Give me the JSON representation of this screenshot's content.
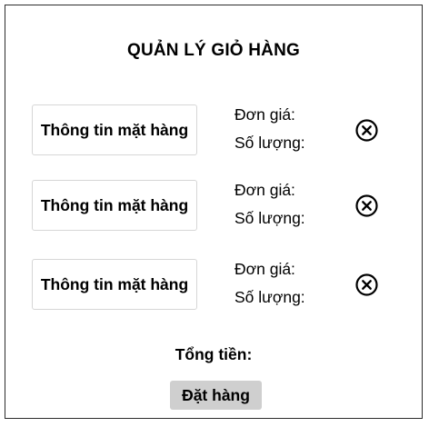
{
  "cart": {
    "title": "QUẢN LÝ GIỎ HÀNG",
    "items": [
      {
        "info_label": "Thông tin mặt hàng",
        "price_label": "Đơn giá:",
        "quantity_label": "Số lượng:",
        "remove_icon": "close-circle-icon"
      },
      {
        "info_label": "Thông tin mặt hàng",
        "price_label": "Đơn giá:",
        "quantity_label": "Số lượng:",
        "remove_icon": "close-circle-icon"
      },
      {
        "info_label": "Thông tin mặt hàng",
        "price_label": "Đơn giá:",
        "quantity_label": "Số lượng:",
        "remove_icon": "close-circle-icon"
      }
    ],
    "total_label": "Tổng tiền:",
    "order_button_label": "Đặt hàng"
  },
  "colors": {
    "button_bg": "#cfcfcf",
    "border": "#2b2b2b",
    "item_border": "#d6d6d6"
  }
}
